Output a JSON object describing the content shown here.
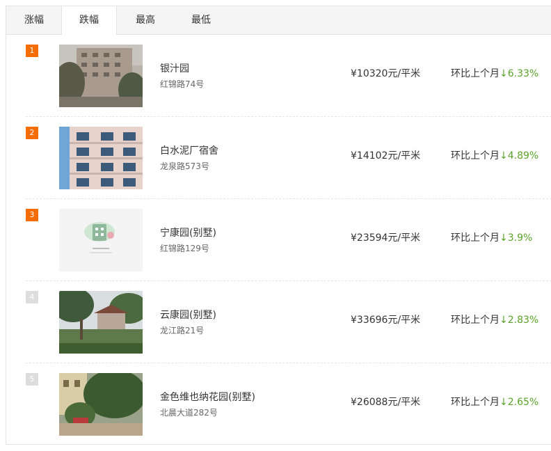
{
  "tabs": [
    {
      "label": "涨幅",
      "active": false
    },
    {
      "label": "跌幅",
      "active": true
    },
    {
      "label": "最高",
      "active": false
    },
    {
      "label": "最低",
      "active": false
    }
  ],
  "trend_label": "环比上个月",
  "items": [
    {
      "rank": "1",
      "name": "银汁园",
      "address": "红锦路74号",
      "price": "¥10320元/平米",
      "change": "↓6.33%",
      "rank_style": "hot"
    },
    {
      "rank": "2",
      "name": "白水泥厂宿舍",
      "address": "龙泉路573号",
      "price": "¥14102元/平米",
      "change": "↓4.89%",
      "rank_style": "hot"
    },
    {
      "rank": "3",
      "name": "宁康园(别墅)",
      "address": "红锦路129号",
      "price": "¥23594元/平米",
      "change": "↓3.9%",
      "rank_style": "hot"
    },
    {
      "rank": "4",
      "name": "云康园(别墅)",
      "address": "龙江路21号",
      "price": "¥33696元/平米",
      "change": "↓2.83%",
      "rank_style": "normal"
    },
    {
      "rank": "5",
      "name": "金色维也纳花园(别墅)",
      "address": "北晨大道282号",
      "price": "¥26088元/平米",
      "change": "↓2.65%",
      "rank_style": "normal"
    }
  ],
  "colors": {
    "rank_hot": "#f56c00",
    "rank_normal": "#dddddd",
    "down": "#5ba22a"
  }
}
